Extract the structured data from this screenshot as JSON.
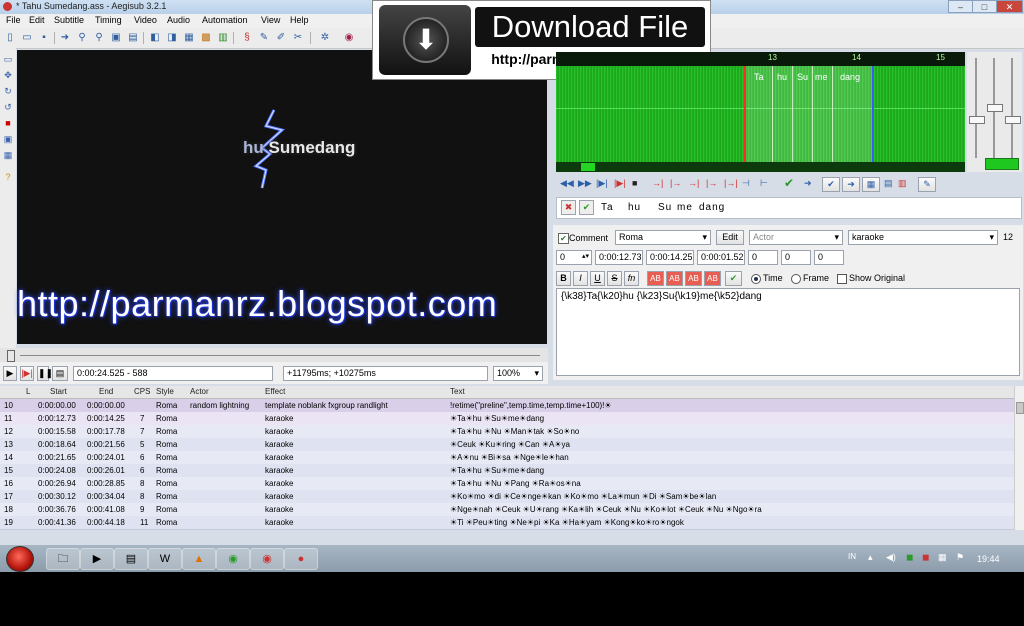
{
  "window": {
    "title": "* Tahu Sumedang.ass - Aegisub 3.2.1",
    "controls": [
      "–",
      "□",
      "✕"
    ]
  },
  "menu": [
    "File",
    "Edit",
    "Subtitle",
    "Timing",
    "Video",
    "Audio",
    "Automation",
    "View",
    "Help"
  ],
  "banner": {
    "title": "Download File",
    "url": "http://parmanrz.blogspot.com"
  },
  "video": {
    "lyric_highlight": "hu",
    "lyric_rest": " Sumedang",
    "overlay_url": "http://parmanrz.blogspot.com",
    "current_time": "0:00:24.525 - 588",
    "offset": "+11795ms; +10275ms",
    "zoom": "100%"
  },
  "audio": {
    "ticks": [
      "13",
      "14",
      "15"
    ],
    "syllables": [
      "Ta",
      "hu",
      "Su",
      "me",
      "dang"
    ]
  },
  "karaoke": {
    "syllables": [
      "Ta",
      "hu",
      "Su",
      "me",
      "dang"
    ]
  },
  "editor": {
    "comment_label": "Comment",
    "style": "Roma",
    "edit_button": "Edit",
    "actor_placeholder": "Actor",
    "effect": "karaoke",
    "effect_num": "12",
    "layer": "0",
    "start": "0:00:12.73",
    "end": "0:00:14.25",
    "duration": "0:00:01.52",
    "margin_l": "0",
    "margin_r": "0",
    "margin_v": "0",
    "fmt_buttons": [
      "B",
      "I",
      "U",
      "S",
      "fn",
      "AB",
      "AB",
      "AB",
      "AB"
    ],
    "time_label": "Time",
    "frame_label": "Frame",
    "show_original_label": "Show Original",
    "text": "{\\k38}Ta{\\k20}hu {\\k23}Su{\\k19}me{\\k52}dang"
  },
  "grid": {
    "headers": [
      "L",
      "Start",
      "End",
      "CPS",
      "Style",
      "Actor",
      "Effect",
      "Text"
    ],
    "rows": [
      {
        "num": "10",
        "start": "0:00:00.00",
        "end": "0:00:00.00",
        "cps": "",
        "style": "Roma",
        "actor": "random lightning",
        "effect": "template noblank fxgroup randlight",
        "text": "!retime(\"preline\",temp.time,temp.time+100)!☀"
      },
      {
        "num": "11",
        "start": "0:00:12.73",
        "end": "0:00:14.25",
        "cps": "7",
        "style": "Roma",
        "actor": "",
        "effect": "karaoke",
        "text": "☀Ta☀hu ☀Su☀me☀dang"
      },
      {
        "num": "12",
        "start": "0:00:15.58",
        "end": "0:00:17.78",
        "cps": "7",
        "style": "Roma",
        "actor": "",
        "effect": "karaoke",
        "text": "☀Ta☀hu ☀Nu ☀Man☀tak ☀So☀no"
      },
      {
        "num": "13",
        "start": "0:00:18.64",
        "end": "0:00:21.56",
        "cps": "5",
        "style": "Roma",
        "actor": "",
        "effect": "karaoke",
        "text": "☀Ceuk ☀Ku☀ring ☀Can ☀A☀ya"
      },
      {
        "num": "14",
        "start": "0:00:21.65",
        "end": "0:00:24.01",
        "cps": "6",
        "style": "Roma",
        "actor": "",
        "effect": "karaoke",
        "text": "☀A☀nu ☀Bi☀sa ☀Nge☀le☀han"
      },
      {
        "num": "15",
        "start": "0:00:24.08",
        "end": "0:00:26.01",
        "cps": "6",
        "style": "Roma",
        "actor": "",
        "effect": "karaoke",
        "text": "☀Ta☀hu ☀Su☀me☀dang"
      },
      {
        "num": "16",
        "start": "0:00:26.94",
        "end": "0:00:28.85",
        "cps": "8",
        "style": "Roma",
        "actor": "",
        "effect": "karaoke",
        "text": "☀Ta☀hu ☀Nu ☀Pang ☀Ra☀os☀na"
      },
      {
        "num": "17",
        "start": "0:00:30.12",
        "end": "0:00:34.04",
        "cps": "8",
        "style": "Roma",
        "actor": "",
        "effect": "karaoke",
        "text": "☀Ko☀mo ☀di ☀Ce☀nge☀kan ☀Ko☀mo ☀La☀mun ☀Di ☀Sam☀be☀lan"
      },
      {
        "num": "18",
        "start": "0:00:36.76",
        "end": "0:00:41.08",
        "cps": "9",
        "style": "Roma",
        "actor": "",
        "effect": "karaoke",
        "text": "☀Nge☀nah ☀Ceuk ☀U☀rang ☀Ka☀lih ☀Ceuk ☀Nu ☀Ko☀lot ☀Ceuk ☀Nu ☀Ngo☀ra"
      },
      {
        "num": "19",
        "start": "0:00:41.36",
        "end": "0:00:44.18",
        "cps": "11",
        "style": "Roma",
        "actor": "",
        "effect": "karaoke",
        "text": "☀Ti ☀Peu☀ting ☀Ne☀pi ☀Ka ☀Ha☀yam ☀Kong☀ko☀ro☀ngok"
      }
    ]
  },
  "taskbar": {
    "lang": "IN",
    "clock": "19:44"
  }
}
